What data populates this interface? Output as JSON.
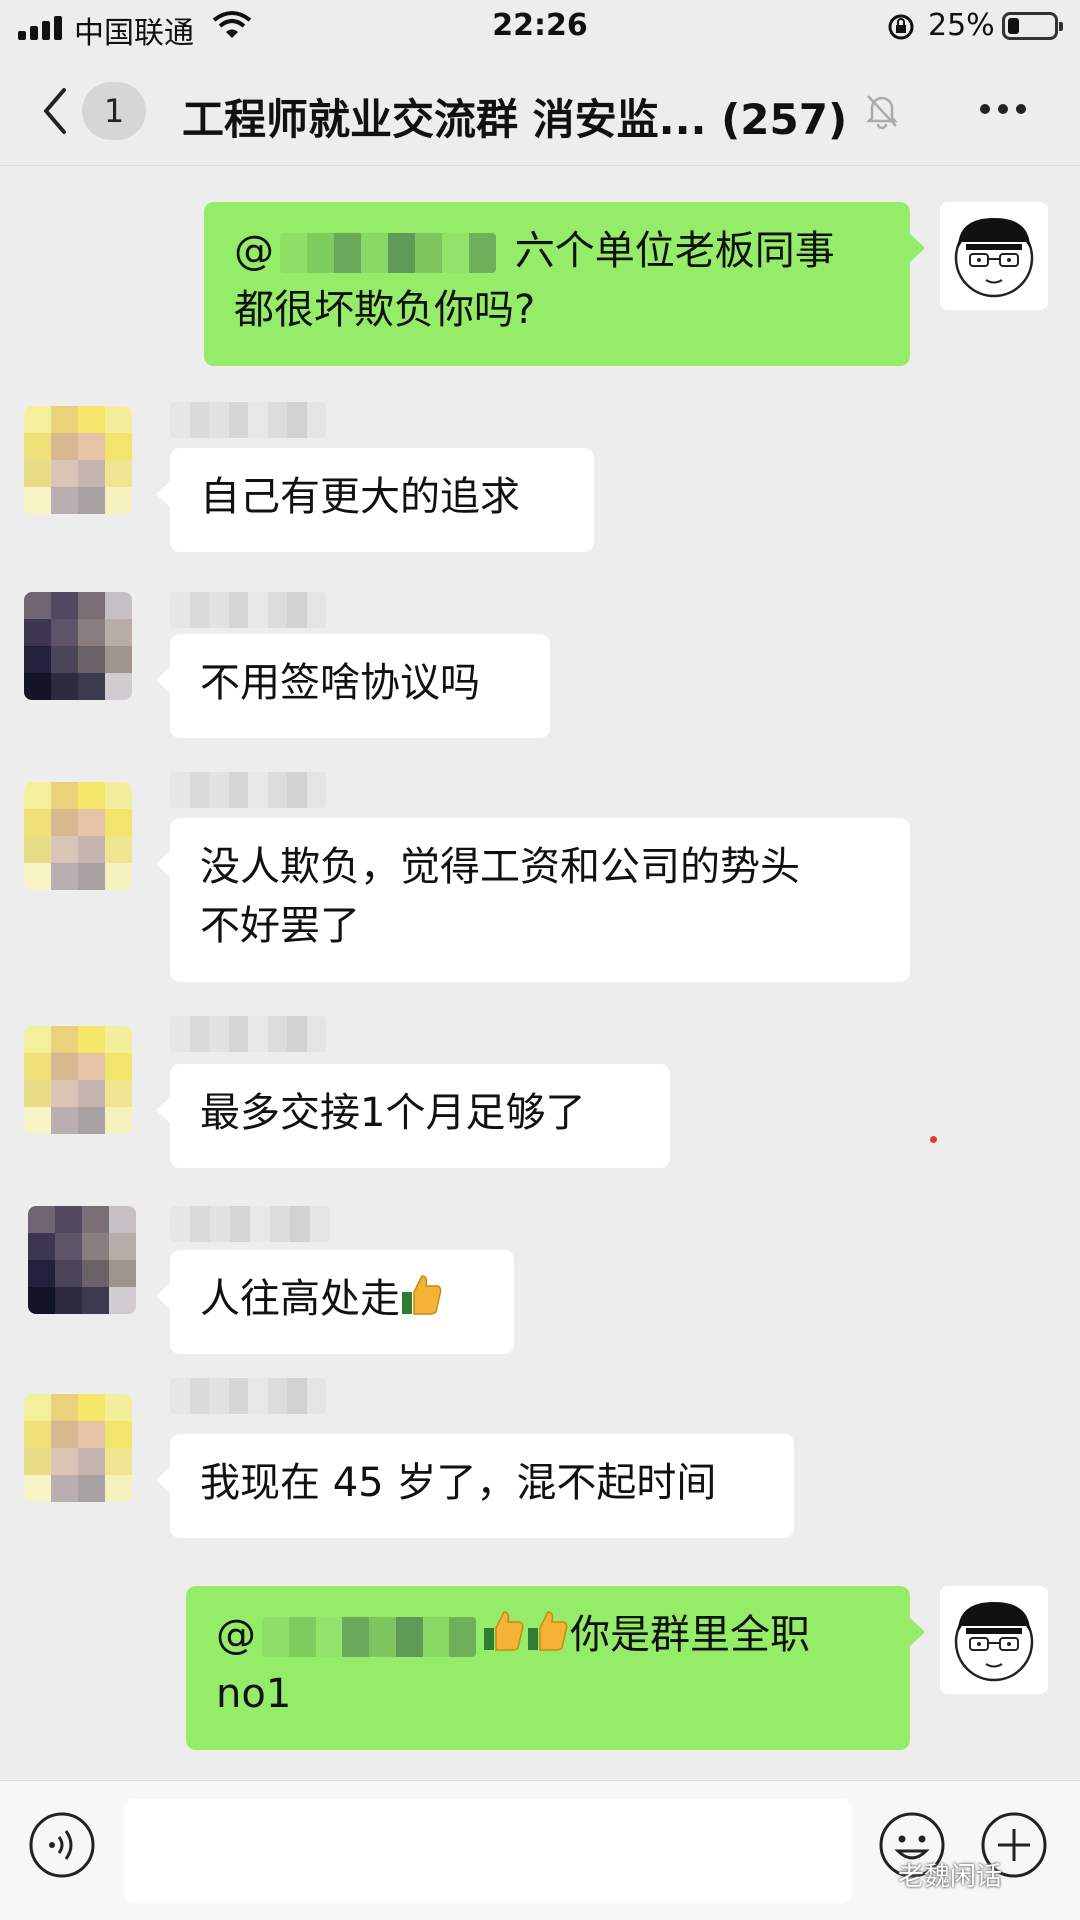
{
  "status_bar": {
    "carrier": "中国联通",
    "time": "22:26",
    "battery_percent": "25%",
    "battery_level": 0.25
  },
  "nav": {
    "unread_count": "1",
    "title": "工程师就业交流群 消安监... (257)"
  },
  "messages": [
    {
      "side": "out",
      "prefix": "@",
      "suffix": " 六个单位老板同事",
      "line2": "都很坏欺负你吗?"
    },
    {
      "side": "in",
      "text": "自己有更大的追求"
    },
    {
      "side": "in",
      "text": "不用签啥协议吗"
    },
    {
      "side": "in",
      "line1": "没人欺负，觉得工资和公司的势头",
      "line2": "不好罢了"
    },
    {
      "side": "in",
      "text": "最多交接1个月足够了"
    },
    {
      "side": "in",
      "text": "人往高处走"
    },
    {
      "side": "in",
      "text": "我现在 45 岁了，混不起时间"
    },
    {
      "side": "out",
      "prefix": "@",
      "suffix": "你是群里全职",
      "line2": "no1"
    }
  ],
  "watermark": "老魏闲话",
  "colors": {
    "background": "#ededed",
    "bubble_out": "#95ec69",
    "bubble_in": "#ffffff"
  },
  "icons": [
    "signal-icon",
    "wifi-icon",
    "rotation-lock-icon",
    "battery-icon",
    "back-arrow-icon",
    "mute-bell-icon",
    "more-icon",
    "thumbs-up-icon",
    "voice-icon",
    "emoji-icon",
    "plus-icon"
  ]
}
